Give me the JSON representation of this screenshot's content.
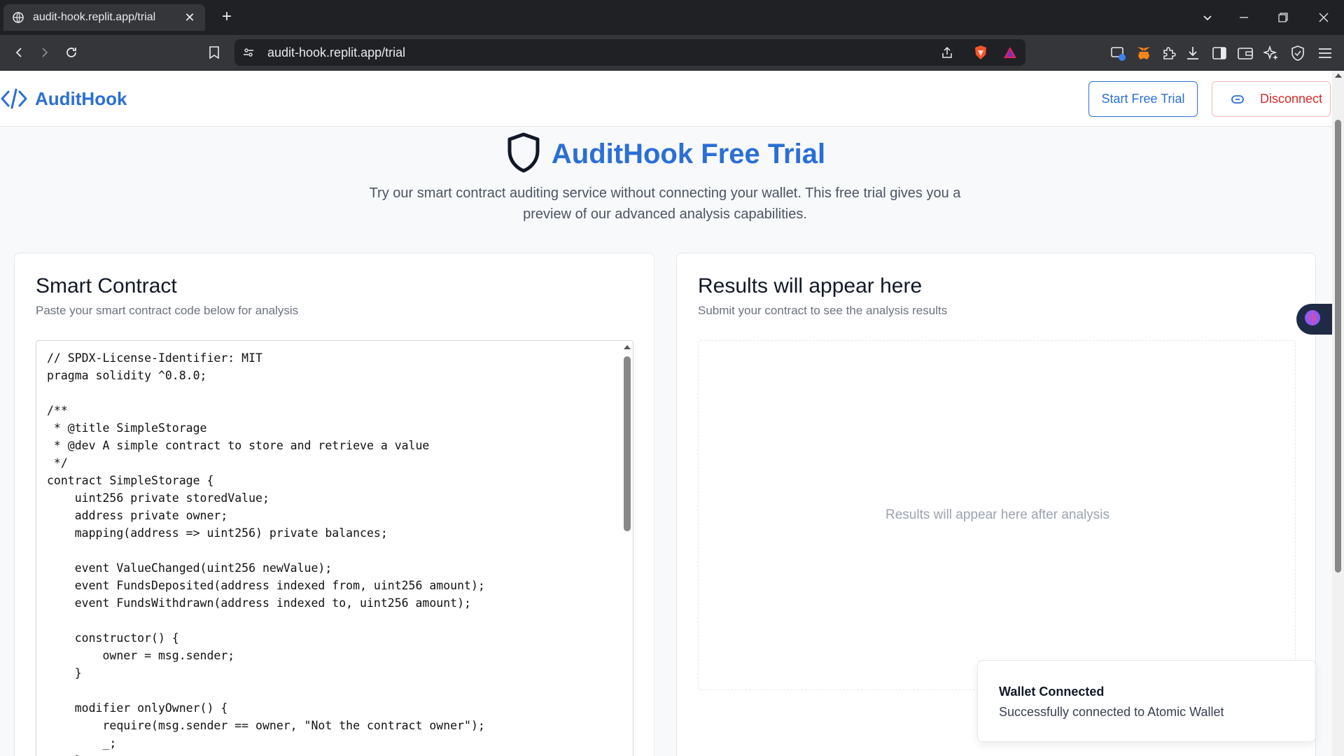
{
  "browser": {
    "tab_title": "audit-hook.replit.app/trial",
    "url": "audit-hook.replit.app/trial"
  },
  "header": {
    "brand": "AuditHook",
    "start_trial_label": "Start Free Trial",
    "disconnect_label": "Disconnect"
  },
  "hero": {
    "title": "AuditHook Free Trial",
    "description": "Try our smart contract auditing service without connecting your wallet. This free trial gives you a preview of our advanced analysis capabilities."
  },
  "contract_card": {
    "title": "Smart Contract",
    "subtitle": "Paste your smart contract code below for analysis",
    "code": "// SPDX-License-Identifier: MIT\npragma solidity ^0.8.0;\n\n/**\n * @title SimpleStorage\n * @dev A simple contract to store and retrieve a value\n */\ncontract SimpleStorage {\n    uint256 private storedValue;\n    address private owner;\n    mapping(address => uint256) private balances;\n\n    event ValueChanged(uint256 newValue);\n    event FundsDeposited(address indexed from, uint256 amount);\n    event FundsWithdrawn(address indexed to, uint256 amount);\n\n    constructor() {\n        owner = msg.sender;\n    }\n\n    modifier onlyOwner() {\n        require(msg.sender == owner, \"Not the contract owner\");\n        _;\n    }"
  },
  "results_card": {
    "title": "Results will appear here",
    "subtitle": "Submit your contract to see the analysis results",
    "placeholder": "Results will appear here after analysis"
  },
  "toast": {
    "title": "Wallet Connected",
    "message": "Successfully connected to Atomic Wallet"
  },
  "colors": {
    "brand": "#2b6fd6",
    "danger": "#d62b2b",
    "page_bg": "#f8f9fa"
  }
}
